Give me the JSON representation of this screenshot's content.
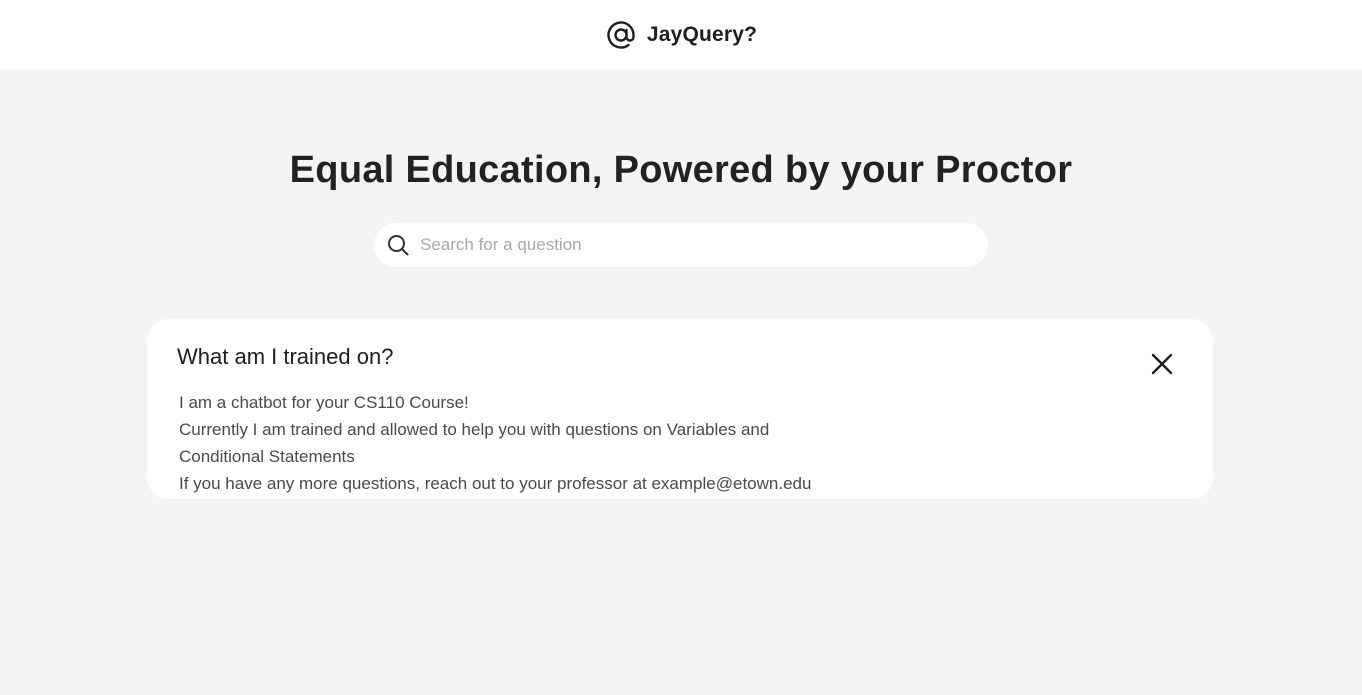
{
  "header": {
    "brand_icon": "at-sign-icon",
    "brand_name": "JayQuery?"
  },
  "hero": {
    "title": "Equal Education, Powered by your Proctor"
  },
  "search": {
    "icon": "search-icon",
    "placeholder": "Search for a question",
    "value": ""
  },
  "info_card": {
    "title": "What am I trained on?",
    "close_icon": "close-icon",
    "lines": [
      "I am a chatbot for your CS110 Course!",
      "Currently I am trained and allowed to help you with questions on Variables and Conditional Statements",
      "If you have any more questions, reach out to your professor at example@etown.edu"
    ]
  }
}
